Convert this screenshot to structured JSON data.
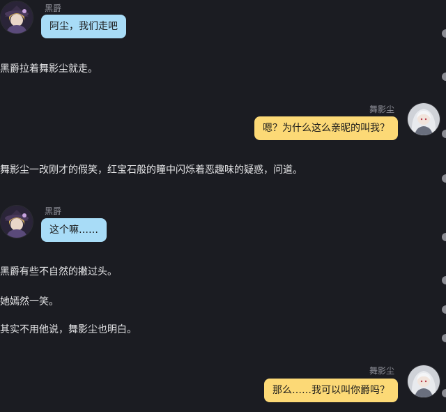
{
  "colors": {
    "background": "#1b1c22",
    "left_bubble": "#a8dcf7",
    "right_bubble": "#fcd976",
    "name_text": "#8f9099",
    "narration_text": "#e6e6e8"
  },
  "characters": {
    "left": {
      "name": "黑爵",
      "avatar": "character-avatar-heijue"
    },
    "right": {
      "name": "舞影尘",
      "avatar": "character-avatar-wuyingchen"
    }
  },
  "messages": [
    {
      "type": "bubble",
      "side": "left",
      "name": "黑爵",
      "text": "阿尘，我们走吧"
    },
    {
      "type": "narration",
      "text": "黑爵拉着舞影尘就走。"
    },
    {
      "type": "bubble",
      "side": "right",
      "name": "舞影尘",
      "text": "嗯？为什么这么亲昵的叫我？"
    },
    {
      "type": "narration",
      "text": "舞影尘一改刚才的假笑，红宝石般的瞳中闪烁着恶趣味的疑惑，问道。"
    },
    {
      "type": "bubble",
      "side": "left",
      "name": "黑爵",
      "text": "这个嘛……"
    },
    {
      "type": "narration",
      "text": "黑爵有些不自然的撇过头。"
    },
    {
      "type": "narration",
      "text": "她嫣然一笑。"
    },
    {
      "type": "narration",
      "text": "其实不用他说，舞影尘也明白。"
    },
    {
      "type": "bubble",
      "side": "right",
      "name": "舞影尘",
      "text": "那么……我可以叫你爵吗？"
    }
  ]
}
